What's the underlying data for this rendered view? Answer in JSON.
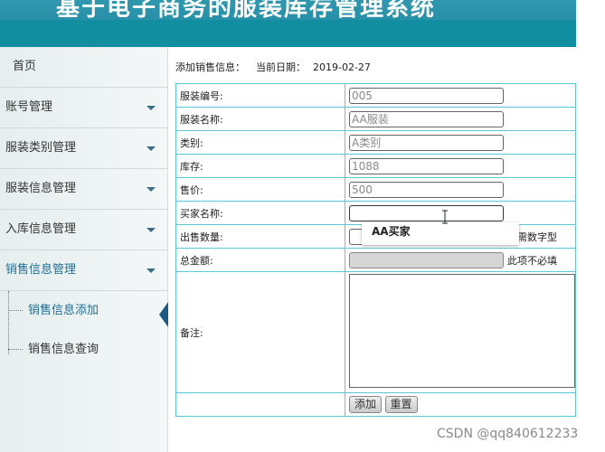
{
  "header": {
    "title": "基于电子商务的服装库存管理系统"
  },
  "sidebar": {
    "items": [
      {
        "label": "首页",
        "has_arrow": false
      },
      {
        "label": "账号管理",
        "has_arrow": true
      },
      {
        "label": "服装类别管理",
        "has_arrow": true
      },
      {
        "label": "服装信息管理",
        "has_arrow": true
      },
      {
        "label": "入库信息管理",
        "has_arrow": true
      },
      {
        "label": "销售信息管理",
        "has_arrow": true,
        "active": true
      }
    ],
    "subitems": [
      {
        "label": "销售信息添加",
        "active": true
      },
      {
        "label": "销售信息查询",
        "active": false
      }
    ]
  },
  "main": {
    "page_label": "添加销售信息：",
    "date_label": "当前日期：",
    "date_value": "2019-02-27",
    "form": {
      "code": {
        "label": "服装编号:",
        "value": "005"
      },
      "name": {
        "label": "服装名称:",
        "value": "AA服装"
      },
      "category": {
        "label": "类别:",
        "value": "A类别"
      },
      "stock": {
        "label": "库存:",
        "value": "1088"
      },
      "price": {
        "label": "售价:",
        "value": "500"
      },
      "buyer": {
        "label": "买家名称:",
        "value": ""
      },
      "quantity": {
        "label": "出售数量:",
        "value": "",
        "note": "必需数字型"
      },
      "total": {
        "label": "总金额:",
        "value": "",
        "note": "此项不必填"
      },
      "remark": {
        "label": "备注:",
        "value": ""
      }
    },
    "buttons": {
      "add": "添加",
      "reset": "重置"
    },
    "autocomplete": {
      "option": "AA买家"
    }
  },
  "watermark": "CSDN @qq840612233"
}
